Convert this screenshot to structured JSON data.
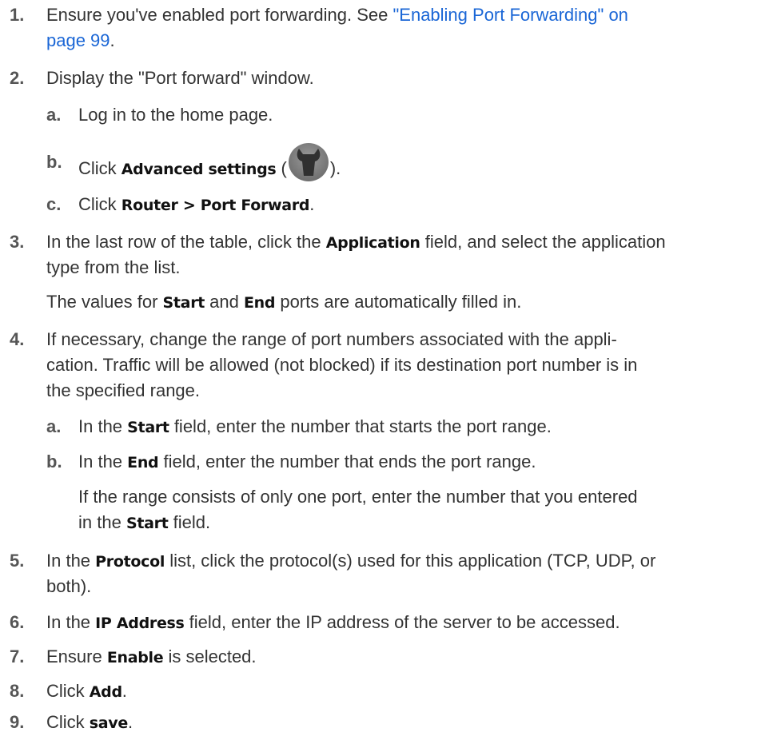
{
  "steps": [
    {
      "n": "1.",
      "line1_text": "Ensure you've enabled port forwarding. See ",
      "line1_link": "\"Enabling Port Forwarding\" on",
      "line2_link": "page 99",
      "line2_text": "."
    },
    {
      "n": "2.",
      "text": "Display the \"Port forward\" window.",
      "subs": [
        {
          "n": "a.",
          "text": "Log in to the home page."
        },
        {
          "n": "b.",
          "pre": "Click ",
          "ui": "Advanced settings",
          "open": " (",
          "icon": "wrench-settings-icon",
          "close": ")."
        },
        {
          "n": "c.",
          "pre": "Click ",
          "ui": "Router > Port Forward",
          "post": "."
        }
      ]
    },
    {
      "n": "3.",
      "line1_pre": "In the last row of the table, click the ",
      "line1_ui": "Application",
      "line1_post": " field, and select the application",
      "line2": "type from the list.",
      "para_pre": "The values for ",
      "para_ui1": "Start",
      "para_mid": " and ",
      "para_ui2": "End",
      "para_post": " ports are automatically filled in."
    },
    {
      "n": "4.",
      "line1": "If necessary, change the range of port numbers associated with the appli-",
      "line2": "cation. Traffic will be allowed (not blocked) if its destination port number is in",
      "line3": "the specified range.",
      "subs": [
        {
          "n": "a.",
          "pre": "In the ",
          "ui": "Start",
          "post": " field, enter the number that starts the port range."
        },
        {
          "n": "b.",
          "pre": "In the ",
          "ui": "End",
          "post": " field, enter the number that ends the port range."
        }
      ],
      "note_line1": "If the range consists of only one port, enter the number that you entered",
      "note_pre": "in the ",
      "note_ui": "Start",
      "note_post": " field."
    },
    {
      "n": "5.",
      "line1_pre": "In the ",
      "line1_ui": "Protocol",
      "line1_post": " list, click the protocol(s) used for this application (TCP, UDP, or",
      "line2": "both)."
    },
    {
      "n": "6.",
      "pre": "In the ",
      "ui": "IP Address",
      "post": " field, enter the IP address of the server to be accessed."
    },
    {
      "n": "7.",
      "pre": "Ensure ",
      "ui": "Enable",
      "post": " is selected."
    },
    {
      "n": "8.",
      "pre": "Click ",
      "ui": "Add",
      "post": "."
    },
    {
      "n": "9.",
      "pre": "Click ",
      "ui": "save",
      "post": "."
    }
  ],
  "colors": {
    "link": "#1a66d6",
    "text": "#333333",
    "icon_bg": "#7a7a7a",
    "icon_fg": "#2f2f2f"
  }
}
